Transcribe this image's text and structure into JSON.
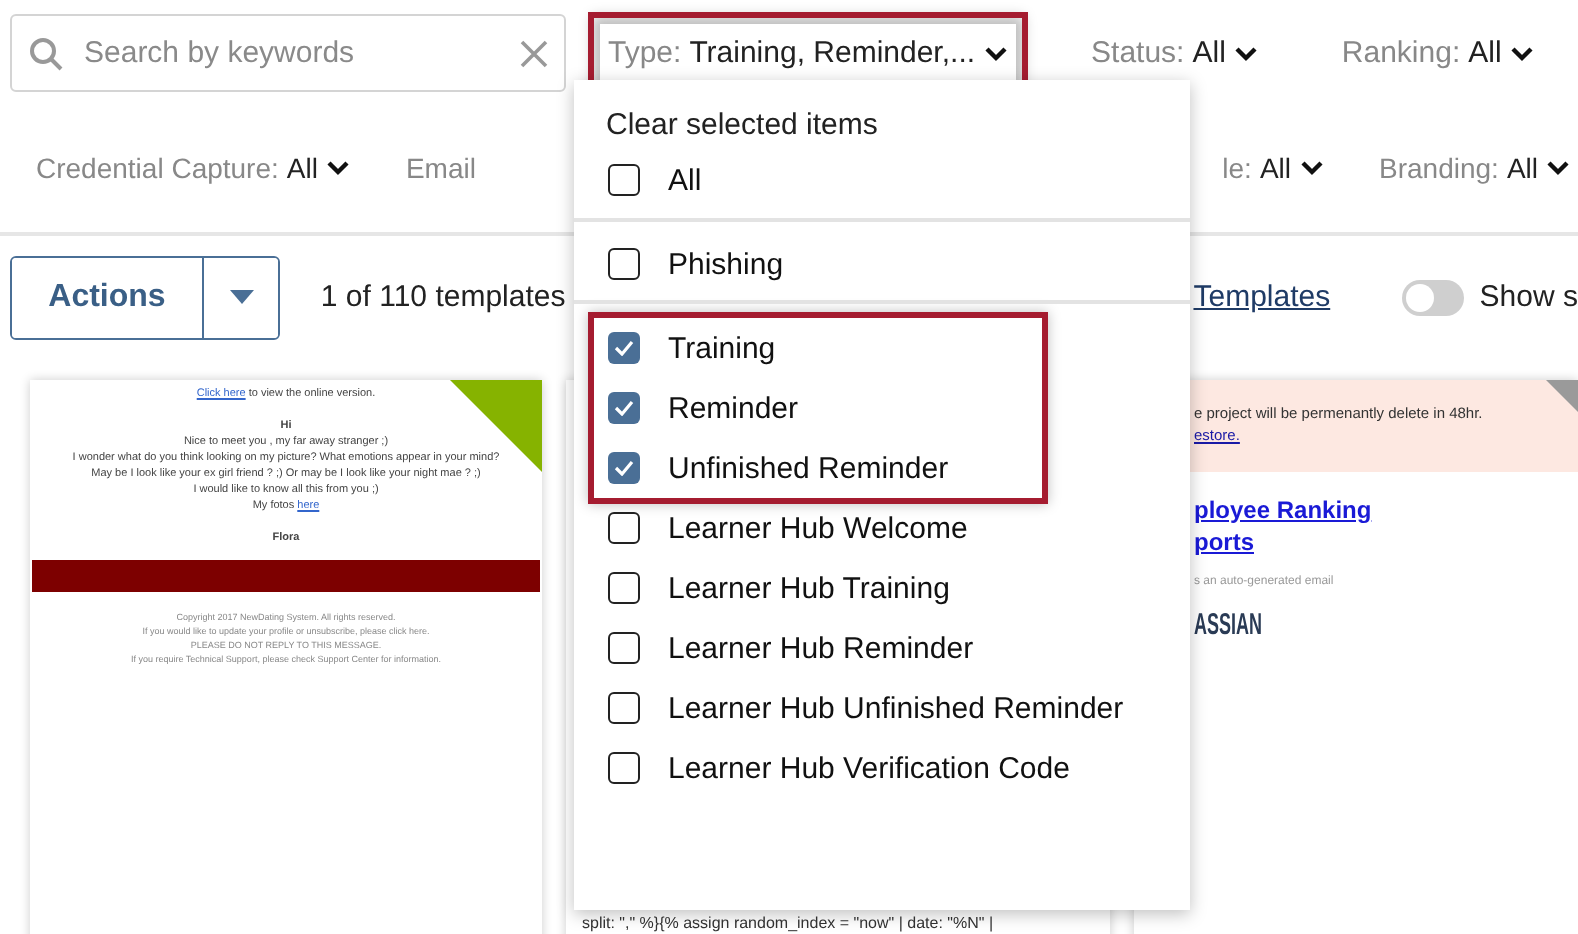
{
  "search": {
    "placeholder": "Search by keywords"
  },
  "filters_row_1": [
    {
      "label": "Type:",
      "value": "Training, Reminder,...",
      "highlighted": true
    },
    {
      "label": "Status:",
      "value": "All",
      "highlighted": false
    },
    {
      "label": "Ranking:",
      "value": "All",
      "highlighted": false
    }
  ],
  "filters_row_2": [
    {
      "label": "Credential Capture:",
      "value": "All"
    },
    {
      "label": "Email"
    },
    {
      "label": "le:",
      "value": "All"
    },
    {
      "label": "Branding:",
      "value": "All"
    }
  ],
  "actions": {
    "label": "Actions",
    "count": "1 of 110 templates",
    "link": "Templates",
    "toggle": {
      "label": "Show s",
      "on": false
    }
  },
  "cards": [
    {
      "kind": "email",
      "color": "#86b300",
      "lines": [
        {
          "kind": "link-line",
          "link": "Click here",
          "text": " to view the online version."
        },
        {
          "kind": "bold",
          "text": "Hi"
        },
        {
          "kind": "text",
          "text": "Nice to meet you , my far away stranger ;)"
        },
        {
          "kind": "text",
          "text": "I wonder what do you think looking on my picture? What emotions appear in your mind?"
        },
        {
          "kind": "text",
          "text": "May be I look like your ex girl friend ? ;) Or may be I look like your night mae ? ;)"
        },
        {
          "kind": "text",
          "text": "I would like to know all this from you ;)"
        },
        {
          "kind": "link-line",
          "text": "My fotos ",
          "link": "here"
        },
        {
          "kind": "bold",
          "text": "Flora"
        },
        {
          "kind": "bar"
        },
        {
          "kind": "small",
          "text": "Copyright 2017 NewDating System. All rights reserved."
        },
        {
          "kind": "small",
          "text": "If you would like to update your profile or unsubscribe, please click here."
        },
        {
          "kind": "small",
          "text": "PLEASE DO NOT REPLY TO THIS MESSAGE."
        },
        {
          "kind": "small",
          "text": "If you require Technical Support, please check Support Center for information."
        }
      ]
    },
    {
      "kind": "code",
      "lines": [
        "split: \",\" %}{% assign random_index = \"now\" | date: \"%N\" |"
      ]
    },
    {
      "kind": "notice",
      "color": "#9a9a9a",
      "banner": "e project will be permenantly delete in 48hr.",
      "banner_link": "estore.",
      "title_lines": [
        "ployee Ranking",
        "ports"
      ],
      "note": "s an auto-generated email",
      "logo": "ASSIAN"
    }
  ],
  "dropdown": {
    "clear_label": "Clear selected items",
    "groups": [
      {
        "divider": false,
        "highlighted": false,
        "options": [
          {
            "label": "All",
            "checked": false
          }
        ]
      },
      {
        "divider": true,
        "highlighted": false,
        "options": [
          {
            "label": "Phishing",
            "checked": false
          }
        ]
      },
      {
        "divider": true,
        "highlighted": true,
        "options": [
          {
            "label": "Training",
            "checked": true
          },
          {
            "label": "Reminder",
            "checked": true
          },
          {
            "label": "Unfinished Reminder",
            "checked": true
          }
        ]
      },
      {
        "divider": false,
        "highlighted": false,
        "options": [
          {
            "label": "Learner Hub Welcome",
            "checked": false
          },
          {
            "label": "Learner Hub Training",
            "checked": false
          },
          {
            "label": "Learner Hub Reminder",
            "checked": false
          },
          {
            "label": "Learner Hub Unfinished Reminder",
            "checked": false
          },
          {
            "label": "Learner Hub Verification Code",
            "checked": false
          }
        ]
      }
    ]
  }
}
